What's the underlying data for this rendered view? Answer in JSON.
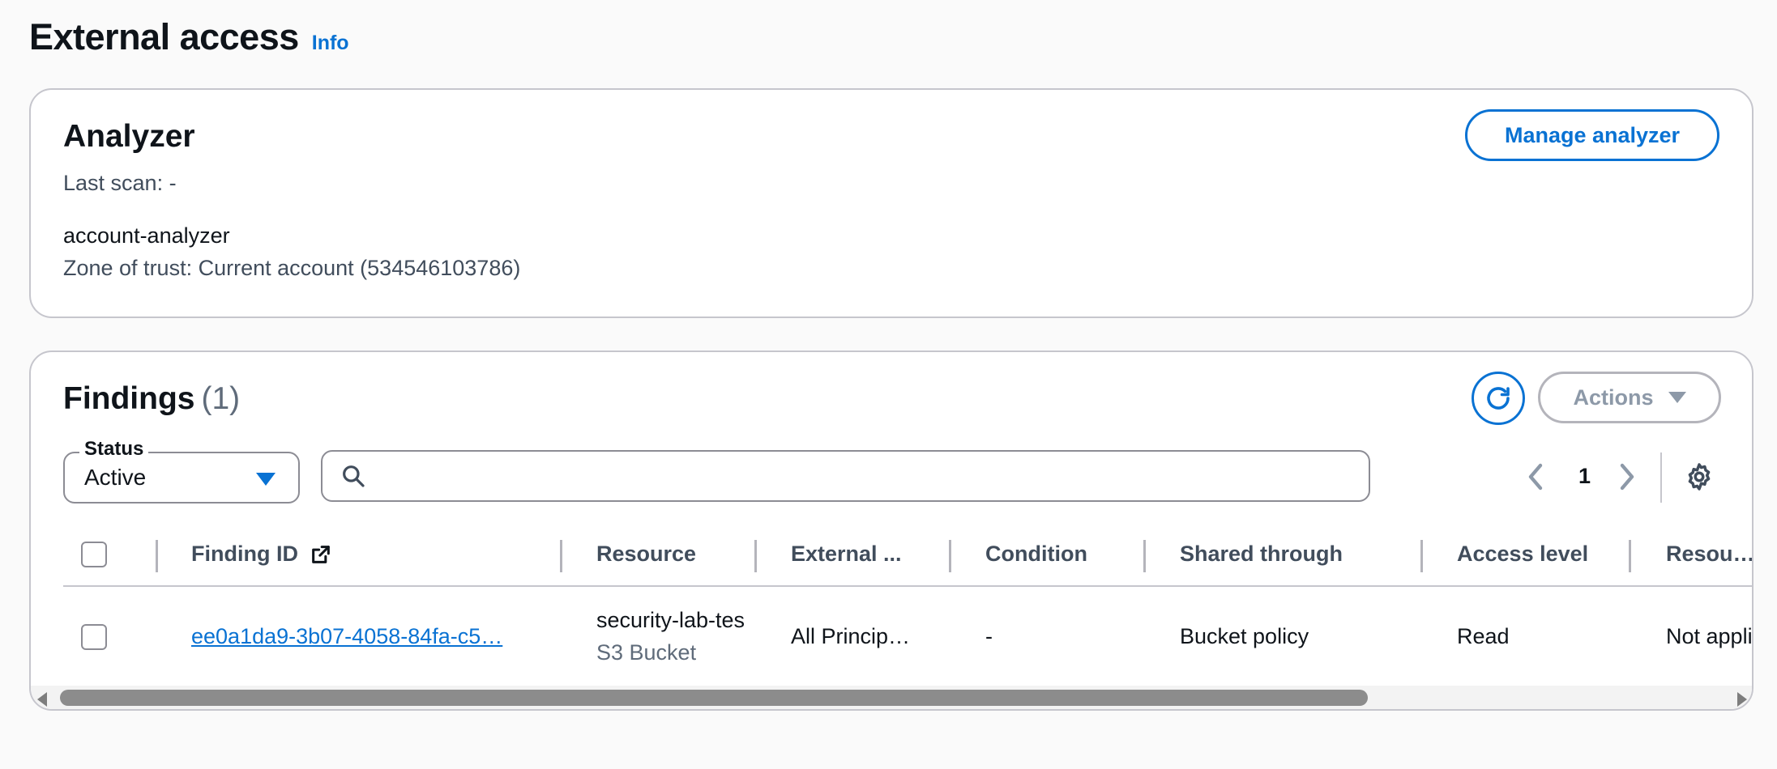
{
  "page": {
    "title": "External access",
    "info_label": "Info"
  },
  "analyzer": {
    "heading": "Analyzer",
    "last_scan": "Last scan: -",
    "name": "account-analyzer",
    "zone_of_trust": "Zone of trust: Current account (534546103786)",
    "manage_button": "Manage analyzer"
  },
  "findings": {
    "heading": "Findings",
    "count": "(1)",
    "actions_button": "Actions",
    "status_filter": {
      "label": "Status",
      "value": "Active"
    },
    "search": {
      "placeholder": "",
      "value": ""
    },
    "pagination": {
      "current_page": "1"
    },
    "columns": [
      "Finding ID",
      "Resource",
      "External ...",
      "Condition",
      "Shared through",
      "Access level",
      "Resour..."
    ],
    "rows": [
      {
        "finding_id": "ee0a1da9-3b07-4058-84fa-c5…",
        "resource_name": "security-lab-tes",
        "resource_type": "S3 Bucket",
        "external_principal": "All Princip…",
        "condition": "-",
        "shared_through": "Bucket policy",
        "access_level": "Read",
        "resource_extra": "Not applica"
      }
    ]
  },
  "colors": {
    "accent": "#0972d3",
    "border": "#c6c6cd",
    "muted_text": "#5f6b7a"
  }
}
